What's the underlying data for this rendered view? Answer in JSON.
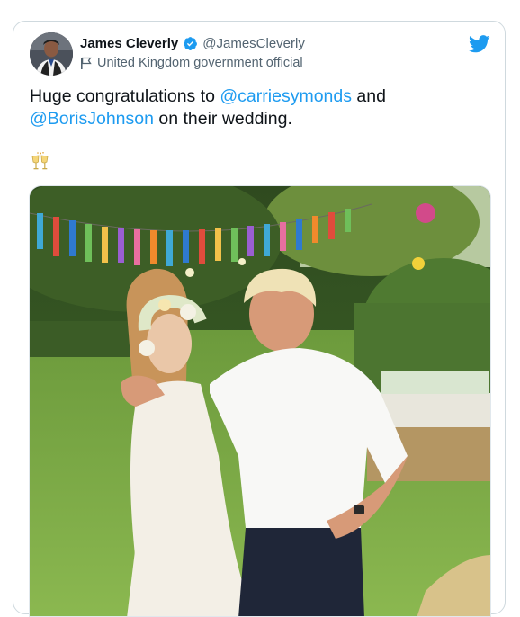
{
  "author": {
    "display_name": "James Cleverly",
    "handle": "@JamesCleverly",
    "label": "United Kingdom government official",
    "verified": true
  },
  "tweet": {
    "text_parts": [
      {
        "text": "Huge congratulations to ",
        "type": "text"
      },
      {
        "text": "@carriesymonds",
        "type": "mention"
      },
      {
        "text": " and ",
        "type": "text"
      },
      {
        "text": "@BorisJohnson",
        "type": "mention"
      },
      {
        "text": " on their wedding.",
        "type": "text"
      }
    ],
    "emoji": "clinking-glasses"
  },
  "colors": {
    "link": "#1d9bf0",
    "verified": "#1d9bf0",
    "twitter_bird": "#1d9bf0",
    "text": "#0f1419",
    "secondary_text": "#536471"
  },
  "icons": {
    "brand": "twitter-bird-icon",
    "verified": "verified-badge-icon",
    "label": "flag-icon"
  },
  "media": {
    "type": "photo",
    "subject": "wedding photo"
  }
}
